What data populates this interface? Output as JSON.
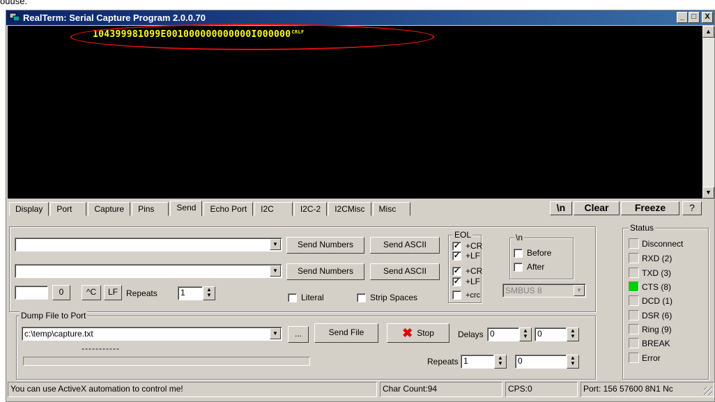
{
  "top_clip_text": "ouuse.",
  "window": {
    "title": "RealTerm: Serial Capture Program 2.0.0.70",
    "btn_min": "_",
    "btn_max": "□",
    "btn_close": "X"
  },
  "terminal": {
    "line": "104399981099E001000000000000I000000",
    "line_end": "CRLF",
    "text_color": "#ffff00",
    "annotation_color": "#e01010"
  },
  "tabs": [
    {
      "label": "Display"
    },
    {
      "label": "Port"
    },
    {
      "label": "Capture"
    },
    {
      "label": "Pins"
    },
    {
      "label": "Send"
    },
    {
      "label": "Echo Port"
    },
    {
      "label": "I2C"
    },
    {
      "label": "I2C-2"
    },
    {
      "label": "I2CMisc"
    },
    {
      "label": "Misc"
    }
  ],
  "active_tab": "Send",
  "toolbar": {
    "newline_label": "\\n",
    "clear_label": "Clear",
    "freeze_label": "Freeze",
    "help_label": "?"
  },
  "send": {
    "row1_value": "",
    "row2_value": "",
    "send_numbers_label": "Send Numbers",
    "send_ascii_label": "Send ASCII",
    "char_value": "",
    "zero_label": "0",
    "ctrl_c_label": "^C",
    "lf_label": "LF",
    "repeats_label": "Repeats",
    "repeats_value": "1",
    "literal_label": "Literal",
    "strip_spaces_label": "Strip Spaces"
  },
  "eol": {
    "title": "EOL",
    "items": [
      {
        "label": "+CR",
        "checked": true
      },
      {
        "label": "+LF",
        "checked": true
      },
      {
        "label": "+CR",
        "checked": true
      },
      {
        "label": "+LF",
        "checked": true
      },
      {
        "label": "+crc",
        "checked": false
      }
    ]
  },
  "newline_group": {
    "title": "\\n",
    "before_label": "Before",
    "after_label": "After",
    "smbus_value": "SMBUS 8"
  },
  "dump": {
    "title": "Dump File to Port",
    "file_value": "c:\\temp\\capture.txt",
    "browse_label": "...",
    "send_file_label": "Send File",
    "stop_label": "Stop",
    "delays_label": "Delays",
    "delay1_value": "0",
    "delay2_value": "0",
    "dots_text": "-----------",
    "repeats_label": "Repeats",
    "repeats1_value": "1",
    "repeats2_value": "0"
  },
  "status": {
    "title": "Status",
    "led_color": "#00d000",
    "items": [
      {
        "label": "Disconnect",
        "on": false
      },
      {
        "label": "RXD (2)",
        "on": false
      },
      {
        "label": "TXD (3)",
        "on": false
      },
      {
        "label": "CTS (8)",
        "on": true
      },
      {
        "label": "DCD (1)",
        "on": false
      },
      {
        "label": "DSR (6)",
        "on": false
      },
      {
        "label": "Ring (9)",
        "on": false
      },
      {
        "label": "BREAK",
        "on": false
      },
      {
        "label": "Error",
        "on": false
      }
    ]
  },
  "statusbar": {
    "message": "You can use ActiveX automation to control me!",
    "char_count": "Char Count:94",
    "cps": "CPS:0",
    "port": "Port: 156 57600 8N1 Nc"
  }
}
